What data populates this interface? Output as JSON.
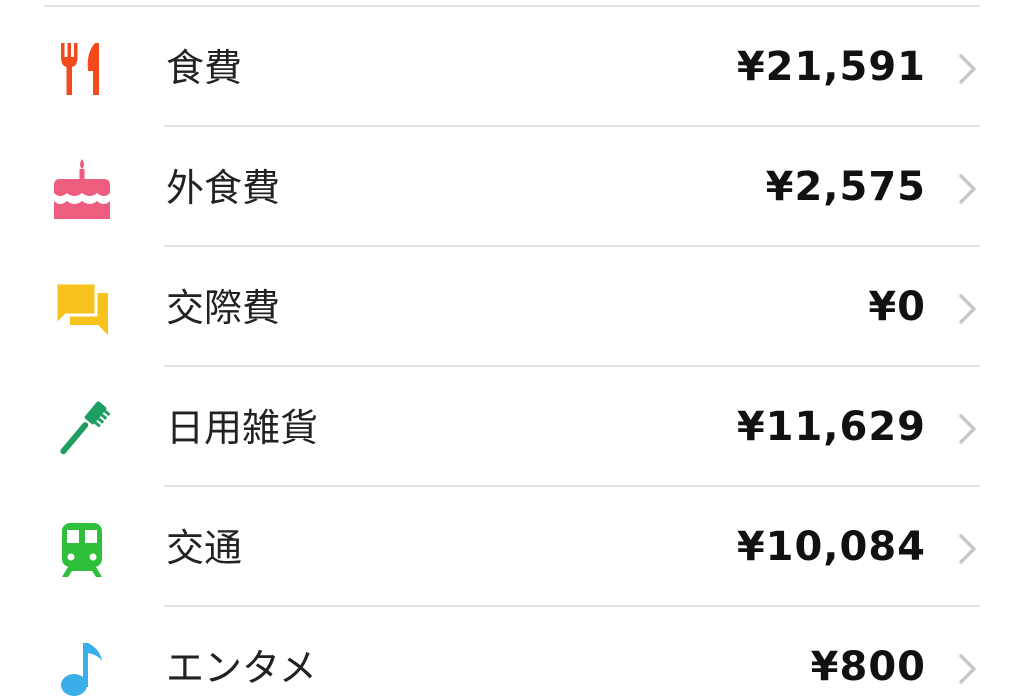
{
  "categories": [
    {
      "label": "食費",
      "amount": "¥21,591",
      "icon": "fork-knife-icon",
      "color": "#f24a1c"
    },
    {
      "label": "外食費",
      "amount": "¥2,575",
      "icon": "cake-icon",
      "color": "#ee5c7e"
    },
    {
      "label": "交際費",
      "amount": "¥0",
      "icon": "chat-bubbles-icon",
      "color": "#f7c21b"
    },
    {
      "label": "日用雑貨",
      "amount": "¥11,629",
      "icon": "toothbrush-icon",
      "color": "#1f9e62"
    },
    {
      "label": "交通",
      "amount": "¥10,084",
      "icon": "train-icon",
      "color": "#2fbf3a"
    },
    {
      "label": "エンタメ",
      "amount": "¥800",
      "icon": "music-note-icon",
      "color": "#3aaee8"
    }
  ],
  "theme": {
    "divider": "#e3e3e3",
    "chevron": "#c7c7cc",
    "text": "#222222"
  }
}
